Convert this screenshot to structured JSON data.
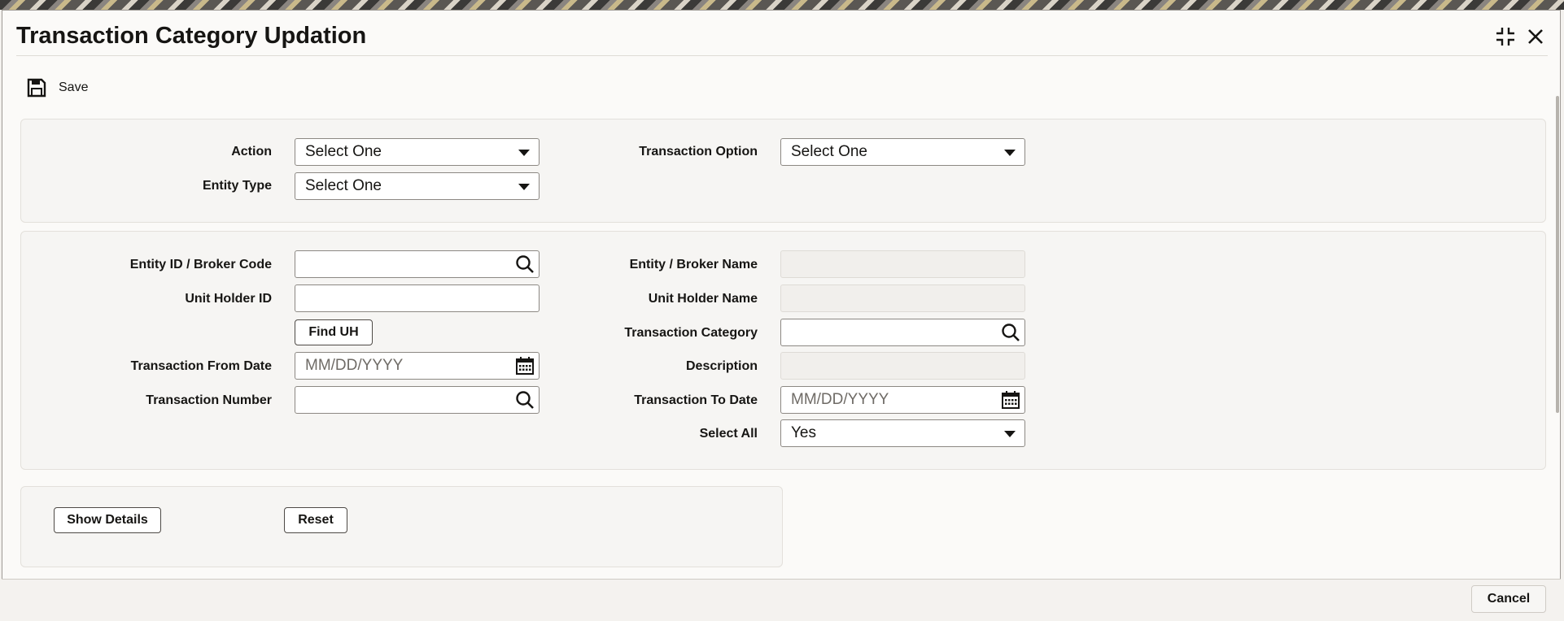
{
  "window": {
    "title": "Transaction Category Updation"
  },
  "toolbar": {
    "save_label": "Save"
  },
  "section1": {
    "action": {
      "label": "Action",
      "value": "Select One"
    },
    "entity_type": {
      "label": "Entity Type",
      "value": "Select One"
    },
    "transaction_option": {
      "label": "Transaction Option",
      "value": "Select One"
    }
  },
  "section2": {
    "entity_id": {
      "label": "Entity ID / Broker Code",
      "value": ""
    },
    "unit_holder_id": {
      "label": "Unit Holder ID",
      "value": ""
    },
    "find_uh_label": "Find UH",
    "from_date": {
      "label": "Transaction From Date",
      "placeholder": "MM/DD/YYYY"
    },
    "transaction_number": {
      "label": "Transaction Number",
      "value": ""
    },
    "entity_name": {
      "label": "Entity / Broker Name",
      "value": ""
    },
    "unit_holder_name": {
      "label": "Unit Holder Name",
      "value": ""
    },
    "transaction_category": {
      "label": "Transaction Category",
      "value": ""
    },
    "description": {
      "label": "Description",
      "value": ""
    },
    "to_date": {
      "label": "Transaction To Date",
      "placeholder": "MM/DD/YYYY"
    },
    "select_all": {
      "label": "Select All",
      "value": "Yes"
    }
  },
  "actions": {
    "show_details_label": "Show Details",
    "reset_label": "Reset"
  },
  "footer": {
    "cancel_label": "Cancel"
  },
  "icons": {
    "save": "save-icon",
    "search": "search-icon",
    "calendar": "calendar-icon",
    "minimize": "minimize-icon",
    "close": "close-icon",
    "dropdown": "chevron-down-icon"
  }
}
